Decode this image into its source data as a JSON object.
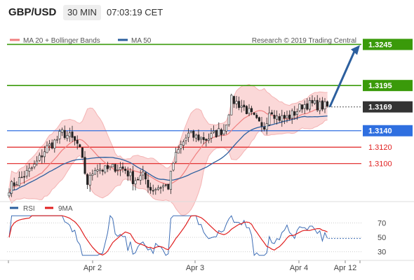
{
  "header": {
    "pair": "GBP/USD",
    "timeframe": "30 MIN",
    "time": "07:03:19 CET"
  },
  "chart_data": [
    {
      "type": "candlestick",
      "legend": [
        {
          "label": "MA 20 + Bollinger Bands",
          "color": "#f08080"
        },
        {
          "label": "MA 50",
          "color": "#2c5f9e"
        }
      ],
      "watermark": "Research © 2019 Trading Central",
      "price_range": [
        1.3058,
        1.3265
      ],
      "levels": [
        {
          "value": 1.3245,
          "label": "1.3245",
          "color": "#3a9a0a",
          "kind": "resistance",
          "style": "filled"
        },
        {
          "value": 1.3195,
          "label": "1.3195",
          "color": "#3a9a0a",
          "kind": "resistance",
          "style": "filled"
        },
        {
          "value": 1.3169,
          "label": "1.3169",
          "color": "#333333",
          "kind": "last",
          "style": "filled"
        },
        {
          "value": 1.314,
          "label": "1.3140",
          "color": "#2f6fe0",
          "kind": "pivot",
          "style": "filled"
        },
        {
          "value": 1.312,
          "label": "1.3120",
          "color": "#e02020",
          "kind": "support",
          "style": "text"
        },
        {
          "value": 1.31,
          "label": "1.3100",
          "color": "#e02020",
          "kind": "support",
          "style": "text"
        }
      ],
      "arrow": {
        "from": 1.3169,
        "to": 1.3245,
        "direction": "up",
        "color": "#2c5f9e"
      },
      "x_ticks": [
        "Apr 2",
        "Apr 3",
        "Apr 4",
        "Apr 12"
      ]
    },
    {
      "type": "line",
      "legend": [
        {
          "label": "RSI",
          "color": "#2c5f9e"
        },
        {
          "label": "9MA",
          "color": "#e02020"
        }
      ],
      "ylim": [
        20,
        85
      ],
      "y_ticks": [
        "70",
        "50",
        "30"
      ]
    }
  ]
}
